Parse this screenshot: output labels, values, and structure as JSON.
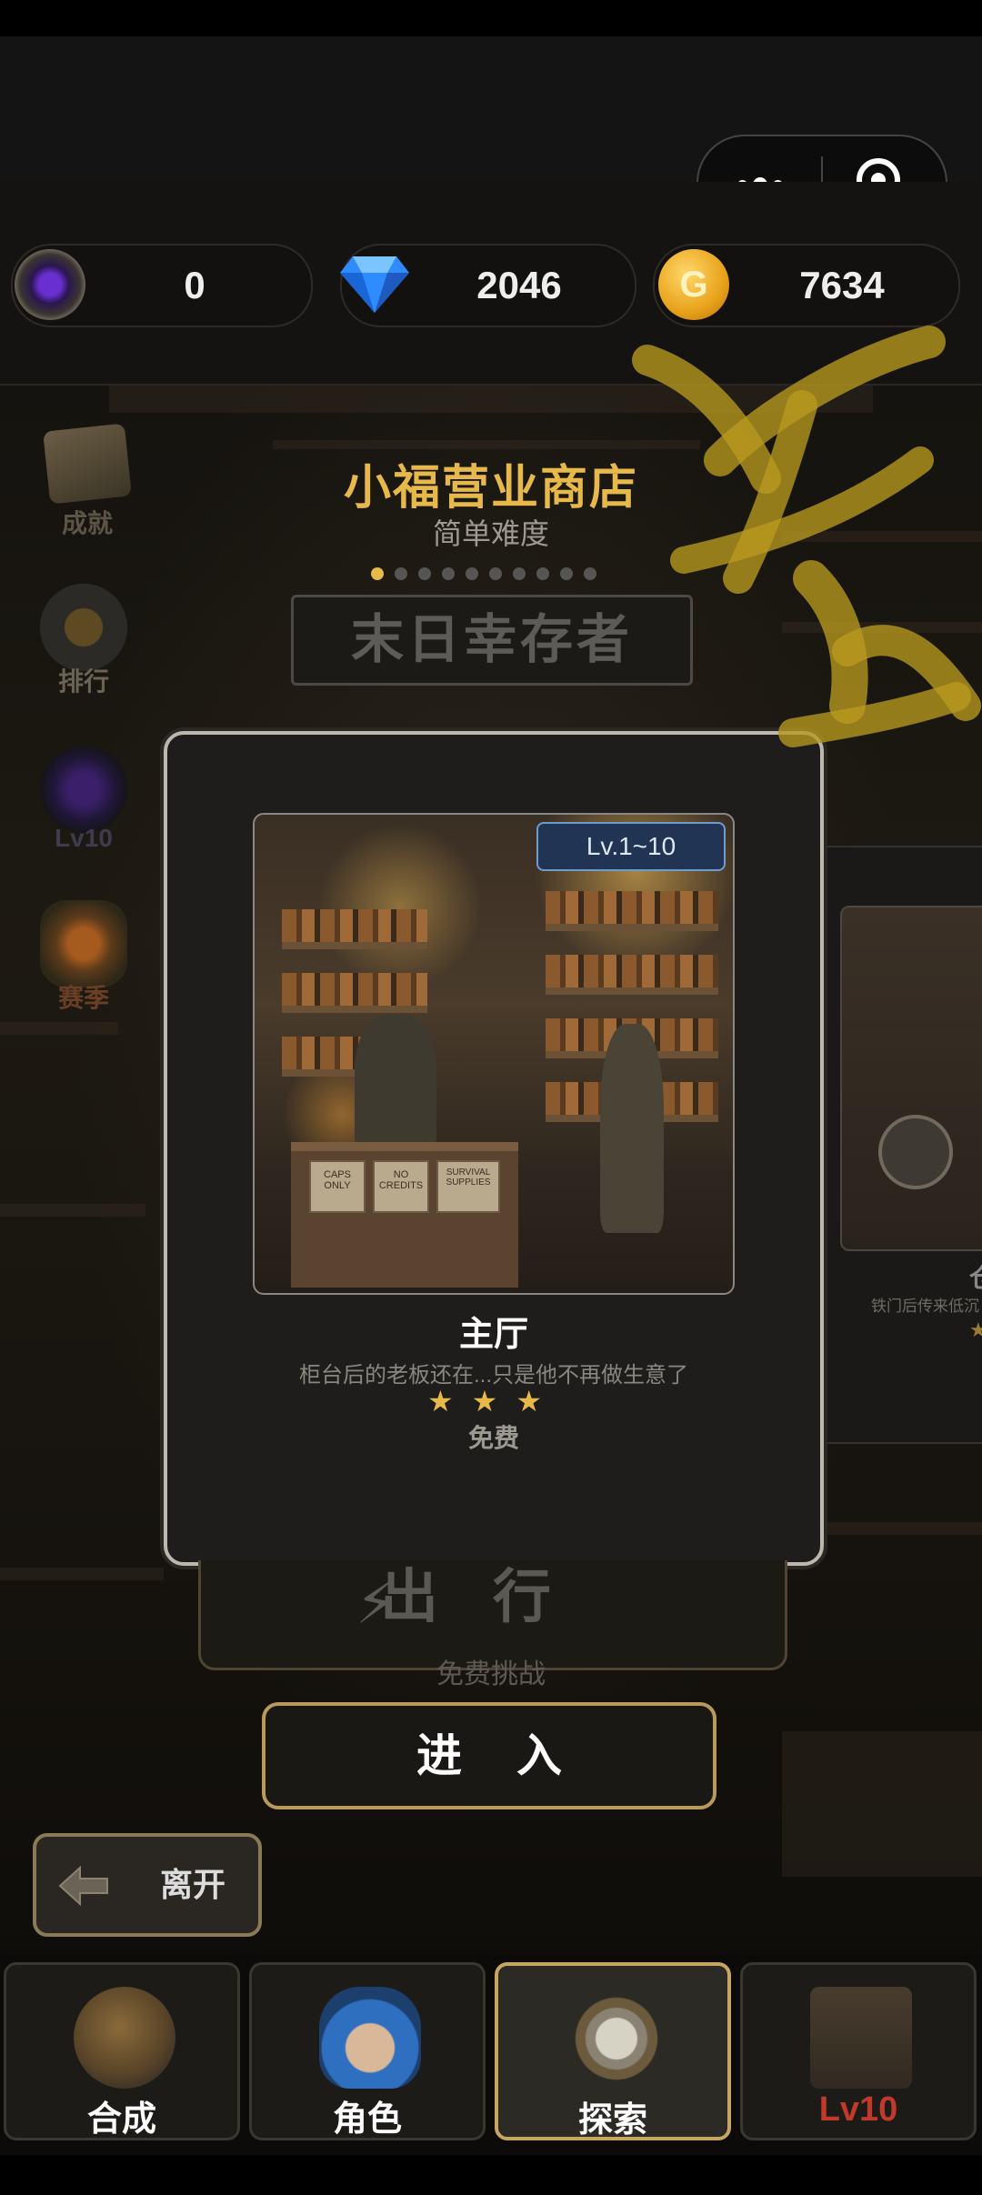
{
  "capsule": {
    "more_label": "more",
    "close_label": "exit"
  },
  "resources": [
    {
      "name": "void-orb",
      "value": "0"
    },
    {
      "name": "diamond",
      "value": "2046"
    },
    {
      "name": "gold-coin",
      "value": "7634",
      "icon_text": "G"
    }
  ],
  "side_nav": [
    {
      "label": "成就",
      "icon": "achievement-scroll-icon"
    },
    {
      "label": "排行",
      "icon": "ranking-trophy-icon"
    },
    {
      "label": "Lv10",
      "icon": "locked-portal-icon"
    },
    {
      "label": "赛季",
      "icon": "season-star-icon"
    }
  ],
  "header": {
    "title": "小福营业商店",
    "difficulty": "简单难度",
    "mode": "末日幸存者",
    "page_count": 10,
    "active_page": 0
  },
  "stage_card": {
    "level_range": "Lv.1~10",
    "title": "主厅",
    "description": "柜台后的老板还在...只是他不再做生意了",
    "stars": "★★★",
    "cost": "免费",
    "signs": [
      "CAPS ONLY",
      "NO CREDITS",
      "SURVIVAL SUPPLIES"
    ]
  },
  "next_card_peek": {
    "title_fragment": "仓",
    "description_fragment": "铁门后传来低沉",
    "star": "★"
  },
  "actions": {
    "go_label": "出行",
    "free_challenge": "免费挑战",
    "enter_label": "进入",
    "leave_label": "离开"
  },
  "bottom_nav": [
    {
      "label": "合成",
      "icon": "craft-tools-icon",
      "active": false
    },
    {
      "label": "角色",
      "icon": "character-portrait-icon",
      "active": false
    },
    {
      "label": "探索",
      "icon": "explore-compass-icon",
      "active": true
    },
    {
      "label": "Lv10",
      "icon": "stash-shop-locked-icon",
      "active": false,
      "locked": true
    }
  ],
  "colors": {
    "accent_gold": "#e7b84a",
    "locked_red": "#c0392b",
    "level_badge_blue": "#213453"
  }
}
